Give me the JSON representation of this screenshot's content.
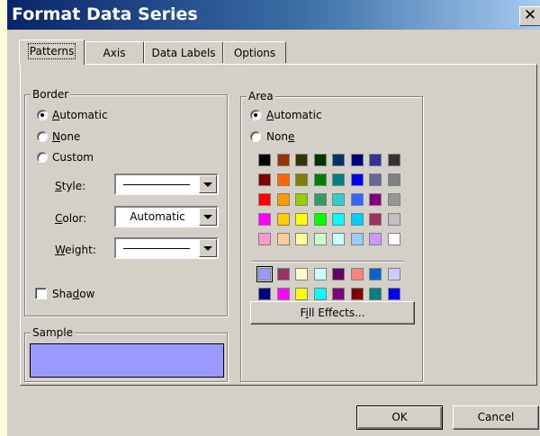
{
  "dialog": {
    "title": "Format Data Series",
    "close_glyph": "✕"
  },
  "tabs": [
    "Patterns",
    "Axis",
    "Data Labels",
    "Options"
  ],
  "border": {
    "legend": "Border",
    "options": {
      "automatic": {
        "underline": "A",
        "rest": "utomatic"
      },
      "none": {
        "underline": "N",
        "rest": "one"
      },
      "custom": {
        "text": "Custom"
      }
    },
    "selected": "automatic",
    "style": {
      "underline": "S",
      "rest": "tyle:"
    },
    "color": {
      "underline": "C",
      "rest": "olor:",
      "value": "Automatic"
    },
    "weight": {
      "underline": "W",
      "rest": "eight:"
    }
  },
  "shadow": {
    "pre": "Sha",
    "underline": "d",
    "post": "ow",
    "checked": false
  },
  "sample": {
    "legend": "Sample",
    "color": "#9999ff"
  },
  "area": {
    "legend": "Area",
    "options": {
      "automatic": {
        "pre": "",
        "underline": "A",
        "post": "utomatic"
      },
      "none": {
        "pre": "Non",
        "underline": "e",
        "post": ""
      }
    },
    "selected": "automatic",
    "palette_main": [
      [
        "#000000",
        "#993300",
        "#333300",
        "#003300",
        "#003366",
        "#000080",
        "#333399",
        "#333333"
      ],
      [
        "#800000",
        "#ff6600",
        "#808000",
        "#008000",
        "#008080",
        "#0000ff",
        "#666699",
        "#808080"
      ],
      [
        "#ff0000",
        "#ff9900",
        "#99cc00",
        "#339966",
        "#33cccc",
        "#3366ff",
        "#800080",
        "#969696"
      ],
      [
        "#ff00ff",
        "#ffcc00",
        "#ffff00",
        "#00ff00",
        "#00ffff",
        "#00ccff",
        "#993366",
        "#c0c0c0"
      ],
      [
        "#ff99cc",
        "#ffcc99",
        "#ffff99",
        "#ccffcc",
        "#ccffff",
        "#99ccff",
        "#cc99ff",
        "#ffffff"
      ]
    ],
    "palette_chart": [
      [
        "#9999ff",
        "#993366",
        "#ffffcc",
        "#ccffff",
        "#660066",
        "#ff8080",
        "#0066cc",
        "#ccccff"
      ],
      [
        "#000080",
        "#ff00ff",
        "#ffff00",
        "#00ffff",
        "#800080",
        "#800000",
        "#008080",
        "#0000ff"
      ]
    ],
    "selected_swatch": "#9999ff",
    "fill_effects": {
      "pre": "F",
      "underline": "i",
      "post": "ll Effects..."
    }
  },
  "buttons": {
    "ok": "OK",
    "cancel": "Cancel"
  }
}
